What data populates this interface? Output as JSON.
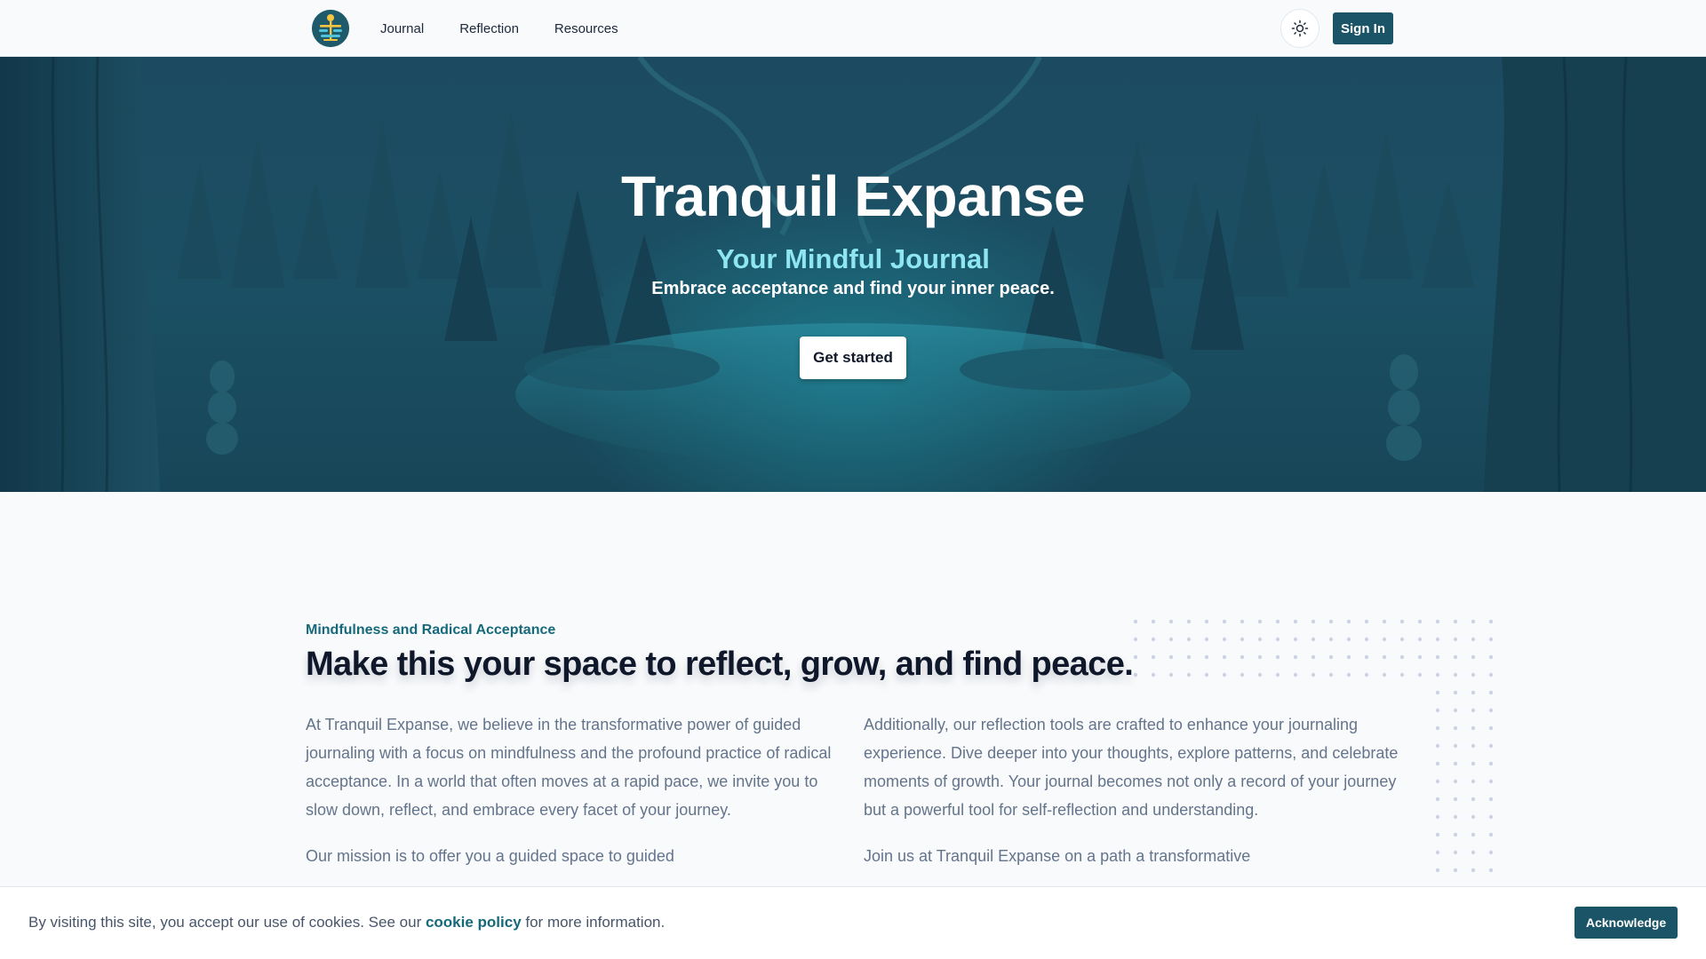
{
  "header": {
    "logo_icon": "balance-lotus-icon",
    "nav": [
      {
        "label": "Journal"
      },
      {
        "label": "Reflection"
      },
      {
        "label": "Resources"
      }
    ],
    "theme_icon": "sun-icon",
    "signin_label": "Sign In"
  },
  "hero": {
    "title": "Tranquil Expanse",
    "subtitle": "Your Mindful Journal",
    "tagline": "Embrace acceptance and find your inner peace.",
    "cta_label": "Get started"
  },
  "about": {
    "eyebrow": "Mindfulness and Radical Acceptance",
    "heading": "Make this your space to reflect, grow, and find peace.",
    "left_paragraphs": [
      "At Tranquil Expanse, we believe in the transformative power of guided journaling with a focus on mindfulness and the profound practice of radical acceptance. In a world that often moves at a rapid pace, we invite you to slow down, reflect, and embrace every facet of your journey.",
      "Our mission is to offer you a guided space to guided"
    ],
    "right_paragraphs": [
      "Additionally, our reflection tools are crafted to enhance your journaling experience. Dive deeper into your thoughts, explore patterns, and celebrate moments of growth. Your journal becomes not only a record of your journey but a powerful tool for self-reflection and understanding.",
      "Join us at Tranquil Expanse on a path a transformative"
    ]
  },
  "cookie": {
    "text_before": "By visiting this site, you accept our use of cookies. See our ",
    "link_label": "cookie policy",
    "text_after": " for more information.",
    "ack_label": "Acknowledge"
  },
  "colors": {
    "brand": "#1a5466",
    "accent_text": "#16697a",
    "hero_subtitle": "#8ee6f2"
  }
}
